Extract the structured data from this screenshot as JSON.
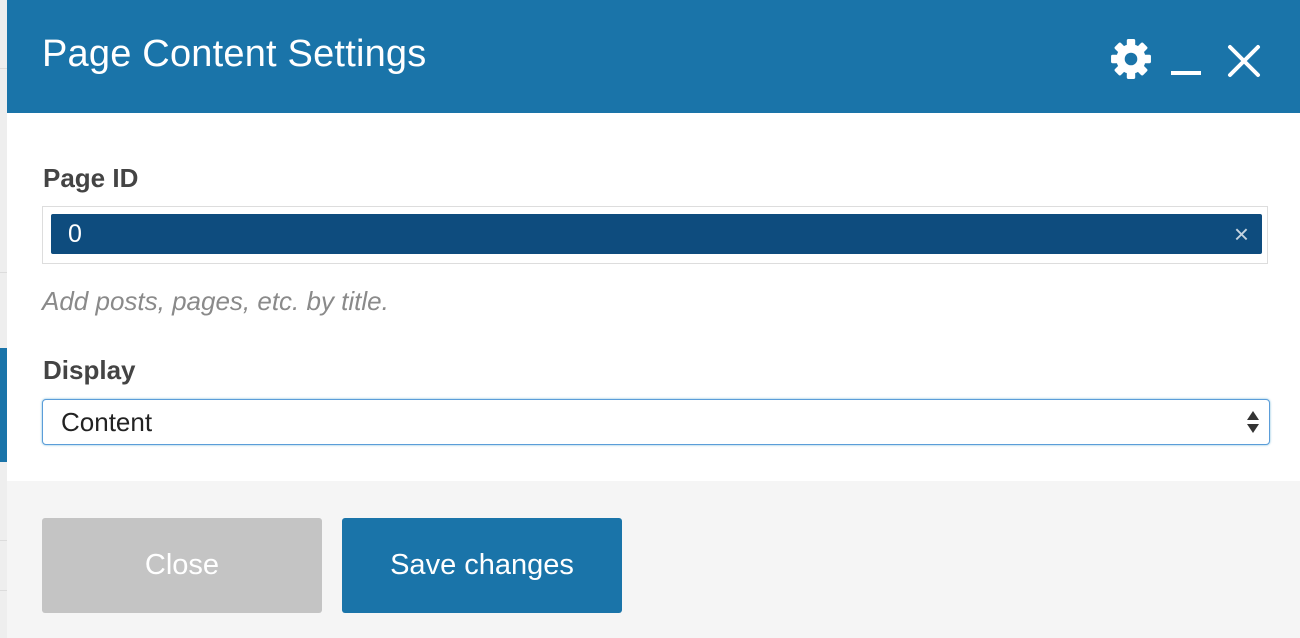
{
  "modal": {
    "title": "Page Content Settings",
    "header_icons": [
      "gear-icon",
      "minimize-icon",
      "close-icon"
    ]
  },
  "fields": {
    "page_id": {
      "label": "Page ID",
      "selected_tag": "0",
      "remove_glyph": "×",
      "help_text": "Add posts, pages, etc. by title."
    },
    "display": {
      "label": "Display",
      "selected_value": "Content"
    }
  },
  "footer": {
    "close_label": "Close",
    "save_label": "Save changes"
  },
  "colors": {
    "header": "#1a74a9",
    "tag_chip": "#0e4c7e",
    "close_button": "#c4c4c4",
    "save_button": "#1a74a9",
    "footer_bg": "#f5f5f5"
  }
}
